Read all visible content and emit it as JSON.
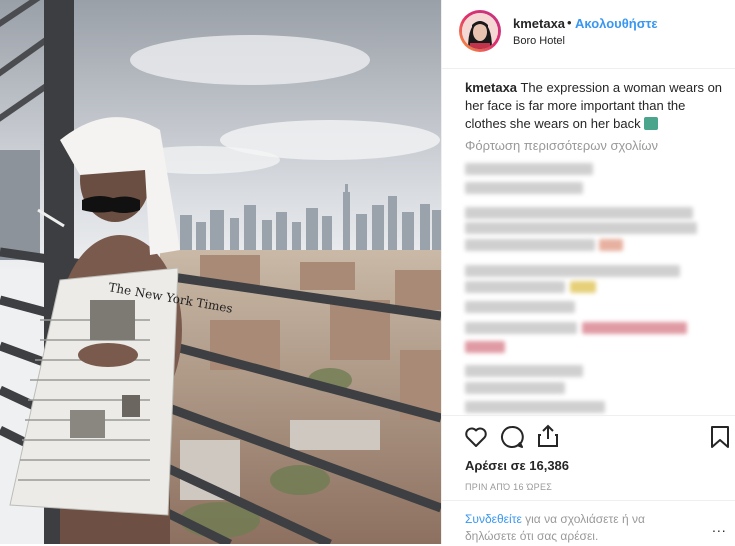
{
  "post": {
    "username": "kmetaxa",
    "follow_label": "Ακολουθήστε",
    "separator": "•",
    "location": "Boro Hotel",
    "caption_text": "The expression a woman wears on her face is far more important than the clothes she wears on her back",
    "caption_emoji": "statue-of-liberty-emoji",
    "load_more": "Φόρτωση περισσότερων σχολίων",
    "likes": "Αρέσει σε 16,386",
    "time_ago": "ΠΡΙΝ ΑΠΌ 16 ΏΡΕΣ",
    "login_link": "Συνδεθείτε",
    "login_rest": " για να σχολιάσετε ή να δηλώσετε ότι σας αρέσει.",
    "more_icon": "..."
  },
  "icons": {
    "like": "heart-icon",
    "comment": "comment-bubble-icon",
    "share": "share-upload-icon",
    "save": "bookmark-icon",
    "more": "ellipsis-icon"
  },
  "colors": {
    "link": "#3897f0",
    "muted": "#999999",
    "text": "#262626",
    "avatar_ring": "#e1306c"
  }
}
